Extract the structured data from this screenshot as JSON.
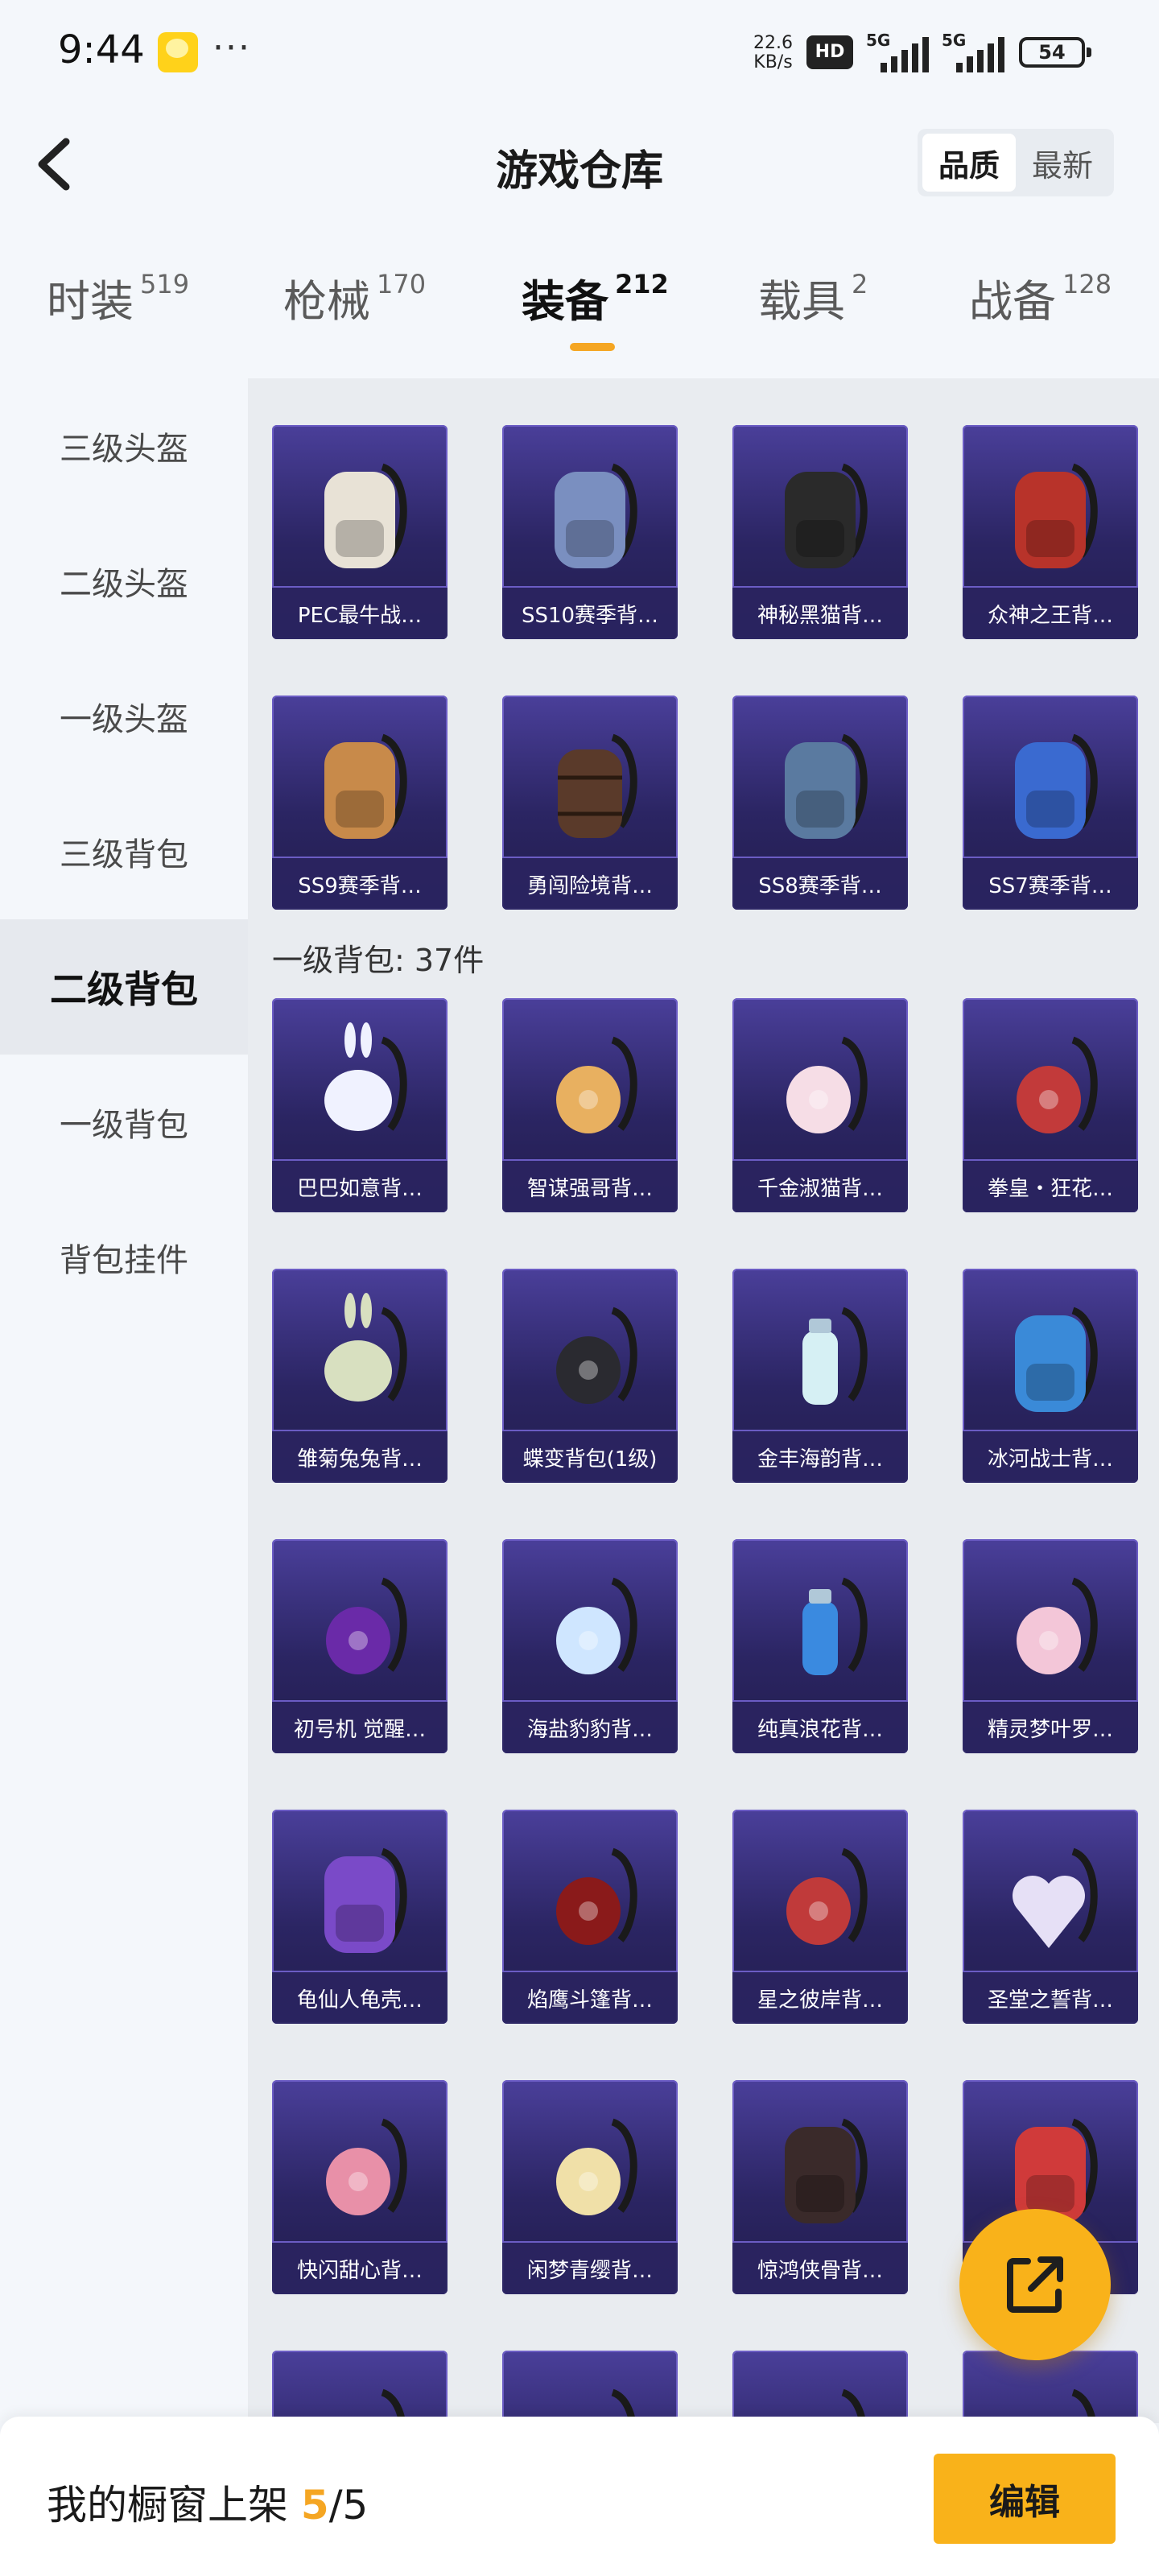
{
  "status_bar": {
    "time": "9:44",
    "speed_value": "22.6",
    "speed_unit": "KB/s",
    "hd": "HD",
    "network1": "5G",
    "network2": "5G",
    "battery": "54"
  },
  "header": {
    "title": "游戏仓库",
    "sort_options": [
      "品质",
      "最新"
    ],
    "sort_active": "品质"
  },
  "tabs": [
    {
      "label": "时装",
      "count": "519"
    },
    {
      "label": "枪械",
      "count": "170"
    },
    {
      "label": "装备",
      "count": "212",
      "active": true
    },
    {
      "label": "载具",
      "count": "2"
    },
    {
      "label": "战备",
      "count": "128"
    }
  ],
  "sidebar": {
    "items": [
      {
        "label": "三级头盔"
      },
      {
        "label": "二级头盔"
      },
      {
        "label": "一级头盔"
      },
      {
        "label": "三级背包"
      },
      {
        "label": "二级背包",
        "active": true
      },
      {
        "label": "一级背包"
      },
      {
        "label": "背包挂件"
      }
    ]
  },
  "sections": [
    {
      "label": "",
      "items": [
        {
          "name": "PEC最牛战…",
          "icon": "guitar-backpack-icon",
          "color": "#e8e2d6"
        },
        {
          "name": "SS10赛季背…",
          "icon": "backpack-icon",
          "color": "#7a8fc0"
        },
        {
          "name": "神秘黑猫背…",
          "icon": "cat-backpack-icon",
          "color": "#2a2a2a"
        },
        {
          "name": "众神之王背…",
          "icon": "backpack-icon",
          "color": "#b8332a"
        },
        {
          "name": "SS9赛季背…",
          "icon": "backpack-icon",
          "color": "#c88a4a"
        },
        {
          "name": "勇闯险境背…",
          "icon": "barrel-backpack-icon",
          "color": "#5a3a2a"
        },
        {
          "name": "SS8赛季背…",
          "icon": "backpack-icon",
          "color": "#5a7aa0"
        },
        {
          "name": "SS7赛季背…",
          "icon": "backpack-icon",
          "color": "#3a6ad0"
        }
      ]
    },
    {
      "label": "一级背包: 37件",
      "items": [
        {
          "name": "巴巴如意背…",
          "icon": "bunny-bag-icon",
          "color": "#f0f2ff"
        },
        {
          "name": "智谋强哥背…",
          "icon": "face-bag-icon",
          "color": "#e8b060"
        },
        {
          "name": "千金淑猫背…",
          "icon": "cat-bag-icon",
          "color": "#f6dde6"
        },
        {
          "name": "拳皇・狂花…",
          "icon": "bag-icon",
          "color": "#c23a3a"
        },
        {
          "name": "雏菊兔兔背…",
          "icon": "bunny-bag-icon",
          "color": "#d8e0c0"
        },
        {
          "name": "蝶变背包(1级)",
          "icon": "bag-icon",
          "color": "#2a2a30"
        },
        {
          "name": "金丰海韵背…",
          "icon": "bottle-bag-icon",
          "color": "#d6f0f4"
        },
        {
          "name": "冰河战士背…",
          "icon": "backpack-icon",
          "color": "#3a8ad8"
        },
        {
          "name": "初号机 觉醒…",
          "icon": "bag-icon",
          "color": "#6a2aa8"
        },
        {
          "name": "海盐豹豹背…",
          "icon": "seal-bag-icon",
          "color": "#cfe6ff"
        },
        {
          "name": "纯真浪花背…",
          "icon": "cup-bag-icon",
          "color": "#3a8ae0"
        },
        {
          "name": "精灵梦叶罗…",
          "icon": "bag-icon",
          "color": "#f3c6d8"
        },
        {
          "name": "龟仙人龟壳…",
          "icon": "backpack-icon",
          "color": "#7a4ac8"
        },
        {
          "name": "焰鹰斗篷背…",
          "icon": "bag-icon",
          "color": "#8a1a1a"
        },
        {
          "name": "星之彼岸背…",
          "icon": "helmet-bag-icon",
          "color": "#c03a3a"
        },
        {
          "name": "圣堂之誓背…",
          "icon": "heart-bag-icon",
          "color": "#e6e0f6"
        },
        {
          "name": "快闪甜心背…",
          "icon": "camera-bag-icon",
          "color": "#e890a8"
        },
        {
          "name": "闲梦青缨背…",
          "icon": "flower-bag-icon",
          "color": "#f0e0a8"
        },
        {
          "name": "惊鸿侠骨背…",
          "icon": "backpack-icon",
          "color": "#3a2a2a"
        },
        {
          "name": "",
          "icon": "backpack-icon",
          "color": "#d03a3a"
        }
      ]
    }
  ],
  "partial_row_colors": [
    "#2a2a2a",
    "#c83030",
    "#e8b0b8",
    "#e0b060"
  ],
  "fab": {
    "icon": "share-icon"
  },
  "bottom_bar": {
    "label": "我的橱窗上架",
    "current": "5",
    "total": "/5",
    "edit_label": "编辑"
  }
}
